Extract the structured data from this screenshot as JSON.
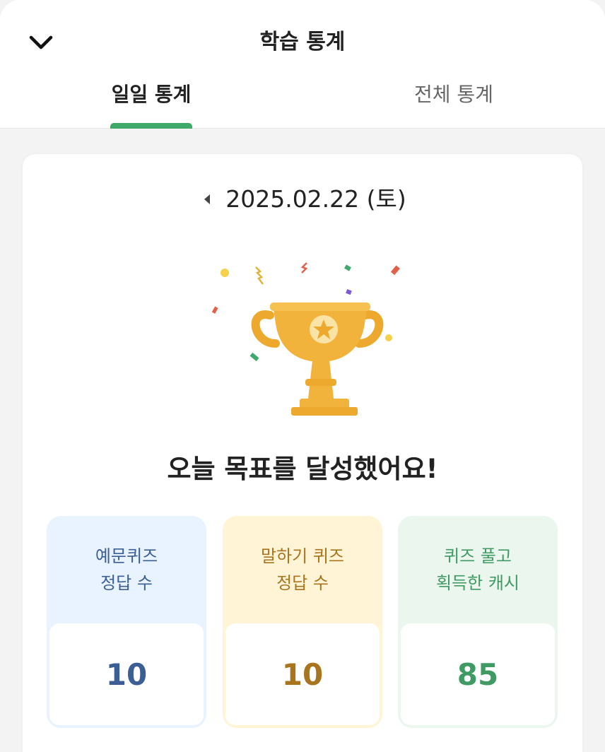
{
  "header": {
    "title": "학습 통계",
    "back_icon": "chevron-down-icon"
  },
  "tabs": [
    {
      "label": "일일 통계",
      "active": true
    },
    {
      "label": "전체 통계",
      "active": false
    }
  ],
  "date_nav": {
    "date": "2025.02.22 (토)",
    "prev_icon": "caret-left-icon"
  },
  "achievement": {
    "icon": "trophy-icon",
    "message": "오늘 목표를 달성했어요!"
  },
  "stats": [
    {
      "line1": "예문퀴즈",
      "line2": "정답 수",
      "value": "10",
      "color": "#3b5f94"
    },
    {
      "line1": "말하기 퀴즈",
      "line2": "정답 수",
      "value": "10",
      "color": "#a8741e"
    },
    {
      "line1": "퀴즈 풀고",
      "line2": "획득한 캐시",
      "value": "85",
      "color": "#3f9a63"
    }
  ],
  "colors": {
    "accent": "#3fa86b",
    "trophy": "#f2b33d"
  }
}
